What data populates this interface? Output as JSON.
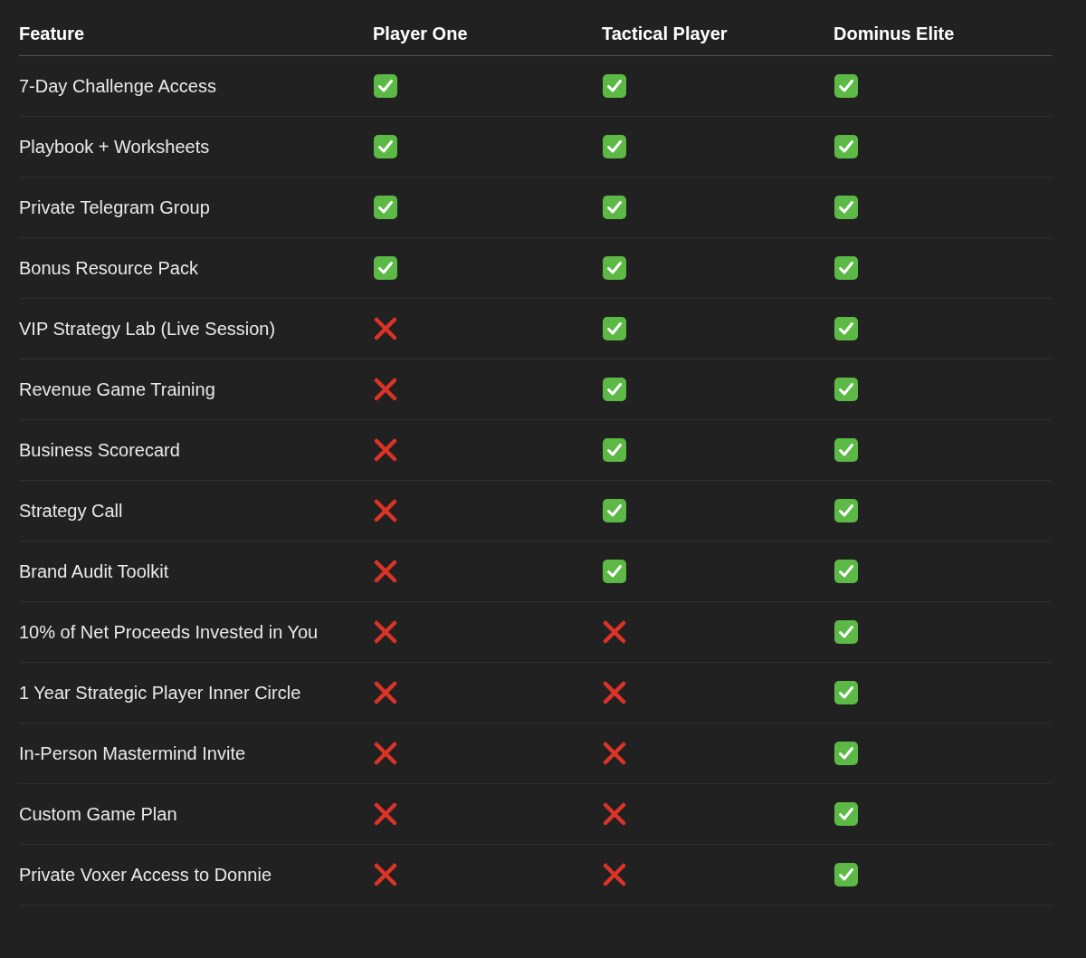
{
  "columns": [
    "Feature",
    "Player One",
    "Tactical Player",
    "Dominus Elite"
  ],
  "rows": [
    {
      "feature": "7-Day Challenge Access",
      "included": [
        true,
        true,
        true
      ]
    },
    {
      "feature": "Playbook + Worksheets",
      "included": [
        true,
        true,
        true
      ]
    },
    {
      "feature": "Private Telegram Group",
      "included": [
        true,
        true,
        true
      ]
    },
    {
      "feature": "Bonus Resource Pack",
      "included": [
        true,
        true,
        true
      ]
    },
    {
      "feature": "VIP Strategy Lab (Live Session)",
      "included": [
        false,
        true,
        true
      ]
    },
    {
      "feature": "Revenue Game Training",
      "included": [
        false,
        true,
        true
      ]
    },
    {
      "feature": "Business Scorecard",
      "included": [
        false,
        true,
        true
      ]
    },
    {
      "feature": "Strategy Call",
      "included": [
        false,
        true,
        true
      ]
    },
    {
      "feature": "Brand Audit Toolkit",
      "included": [
        false,
        true,
        true
      ]
    },
    {
      "feature": "10% of Net Proceeds Invested in You",
      "included": [
        false,
        false,
        true
      ]
    },
    {
      "feature": "1 Year Strategic Player Inner Circle",
      "included": [
        false,
        false,
        true
      ]
    },
    {
      "feature": "In-Person Mastermind Invite",
      "included": [
        false,
        false,
        true
      ]
    },
    {
      "feature": "Custom Game Plan",
      "included": [
        false,
        false,
        true
      ]
    },
    {
      "feature": "Private Voxer Access to Donnie",
      "included": [
        false,
        false,
        true
      ]
    }
  ]
}
